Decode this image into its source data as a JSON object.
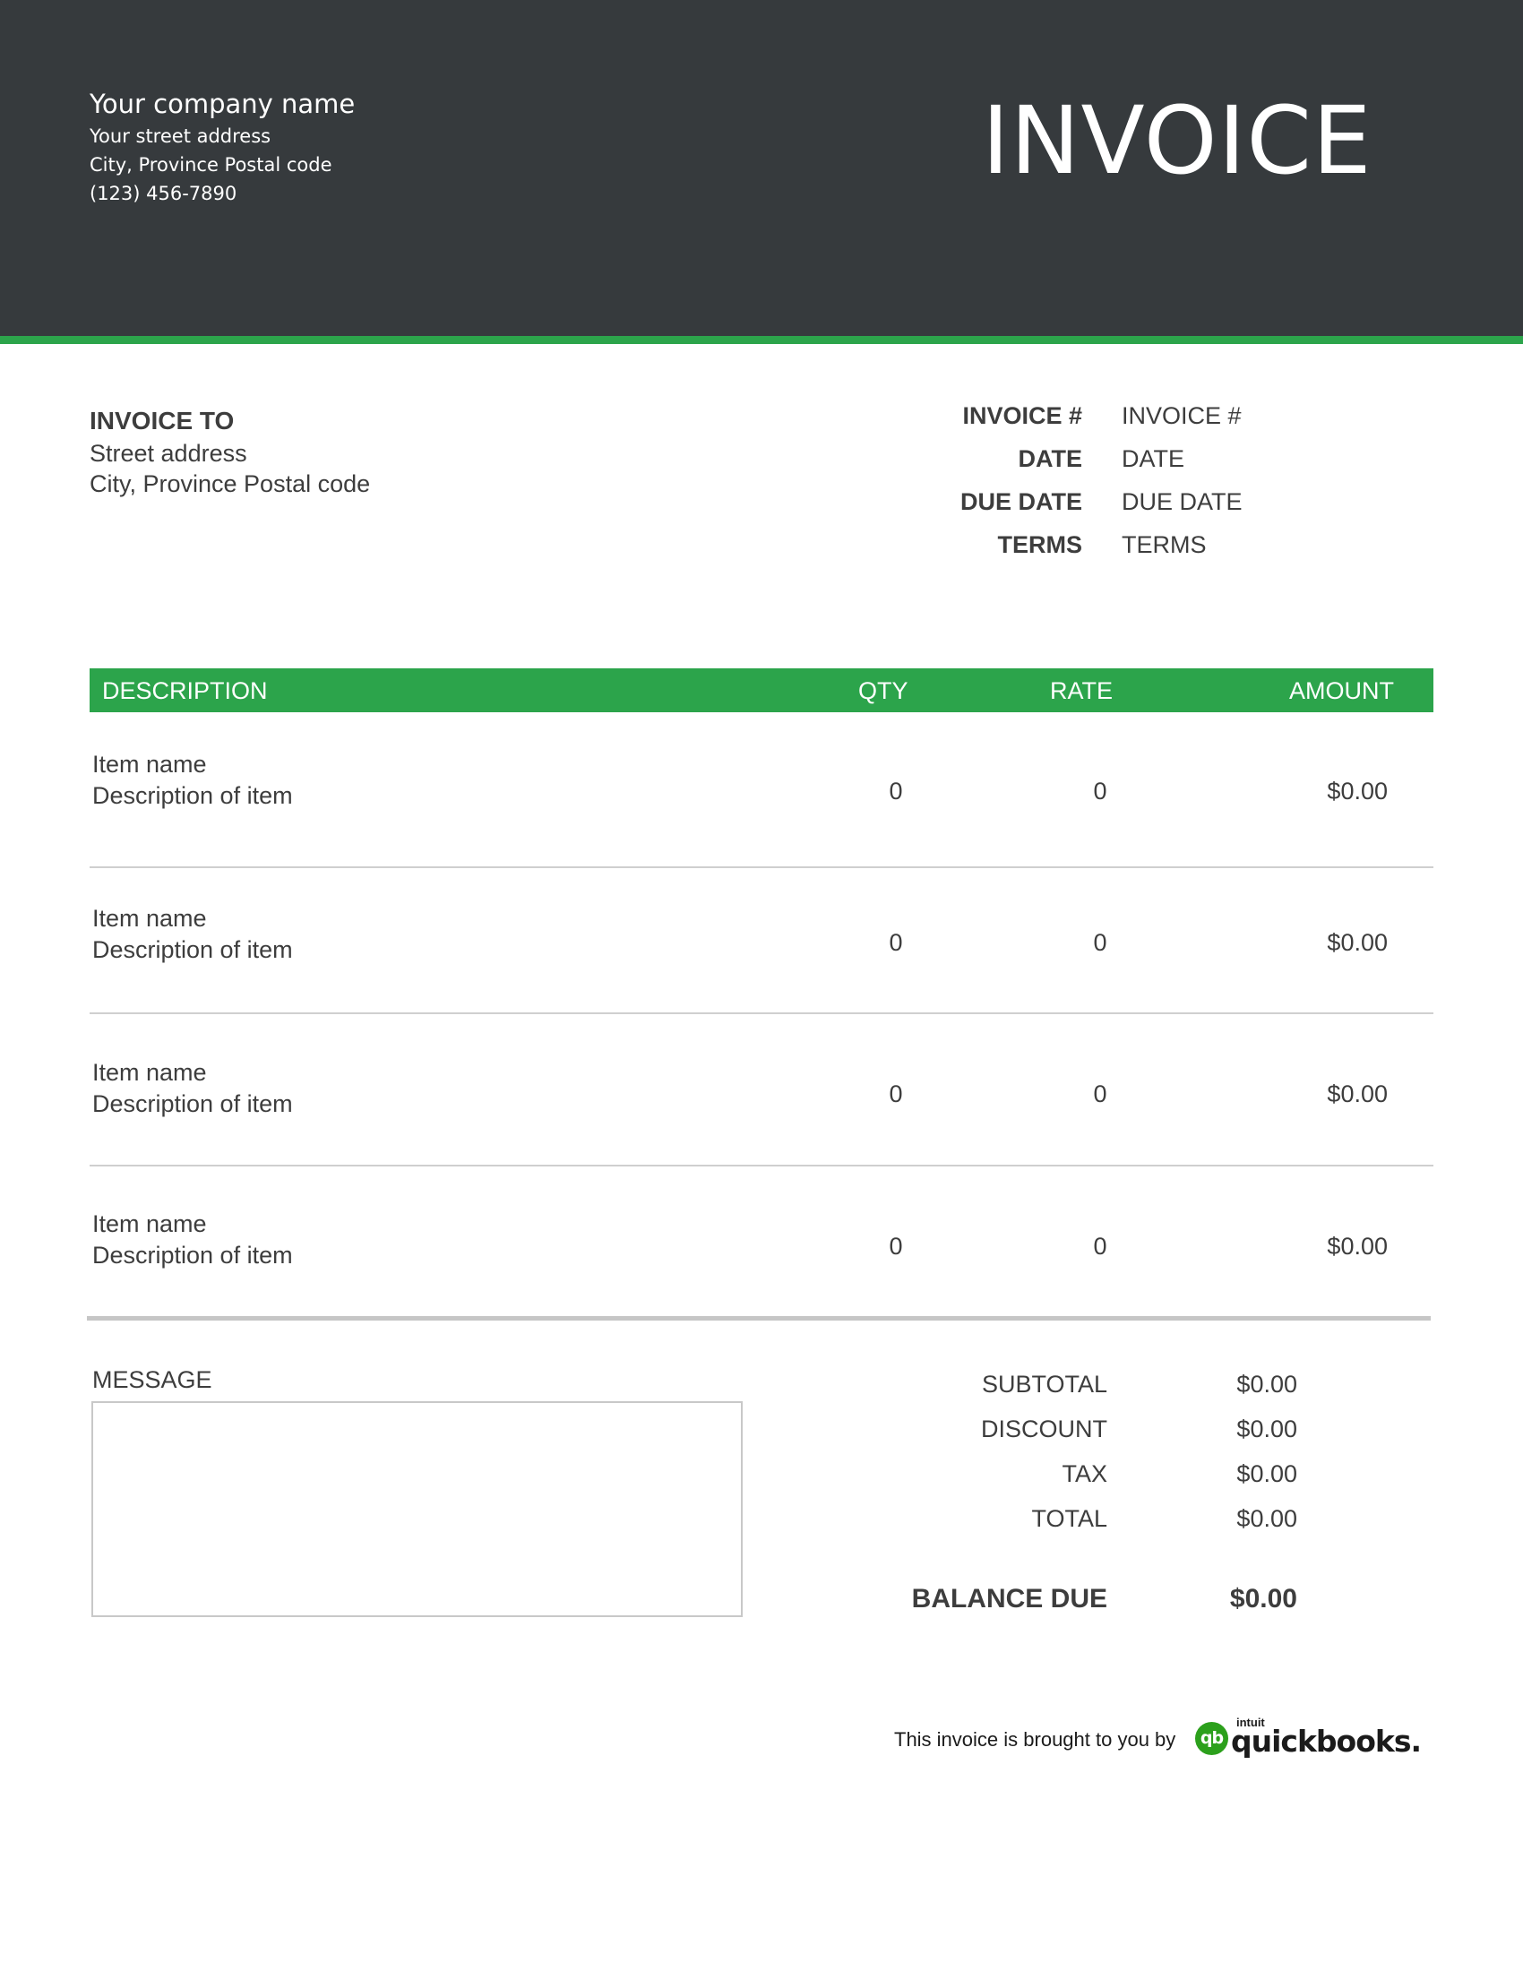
{
  "company": {
    "name": "Your company name",
    "street": "Your street address",
    "city": "City, Province Postal code",
    "phone": "(123) 456-7890"
  },
  "title": "INVOICE",
  "bill_to": {
    "heading": "INVOICE TO",
    "street": "Street address",
    "city": "City, Province Postal code"
  },
  "meta": [
    {
      "label": "INVOICE #",
      "value": "INVOICE #"
    },
    {
      "label": "DATE",
      "value": "DATE"
    },
    {
      "label": "DUE DATE",
      "value": "DUE DATE"
    },
    {
      "label": "TERMS",
      "value": "TERMS"
    }
  ],
  "columns": {
    "description": "DESCRIPTION",
    "qty": "QTY",
    "rate": "RATE",
    "amount": "AMOUNT"
  },
  "items": [
    {
      "name": "Item name",
      "description": "Description of item",
      "qty": "0",
      "rate": "0",
      "amount": "$0.00"
    },
    {
      "name": "Item name",
      "description": "Description of item",
      "qty": "0",
      "rate": "0",
      "amount": "$0.00"
    },
    {
      "name": "Item name",
      "description": "Description of item",
      "qty": "0",
      "rate": "0",
      "amount": "$0.00"
    },
    {
      "name": "Item name",
      "description": "Description of item",
      "qty": "0",
      "rate": "0",
      "amount": "$0.00"
    }
  ],
  "message_label": "MESSAGE",
  "totals": [
    {
      "label": "SUBTOTAL",
      "value": "$0.00"
    },
    {
      "label": "DISCOUNT",
      "value": "$0.00"
    },
    {
      "label": "TAX",
      "value": "$0.00"
    },
    {
      "label": "TOTAL",
      "value": "$0.00"
    }
  ],
  "balance_due": {
    "label": "BALANCE DUE",
    "value": "$0.00"
  },
  "footer": {
    "text": "This invoice is brought to you by",
    "logo_badge": "qb",
    "logo_brand": "intuit",
    "logo_word": "quickbooks."
  },
  "colors": {
    "header_bg": "#363a3d",
    "accent": "#2ca44b"
  }
}
